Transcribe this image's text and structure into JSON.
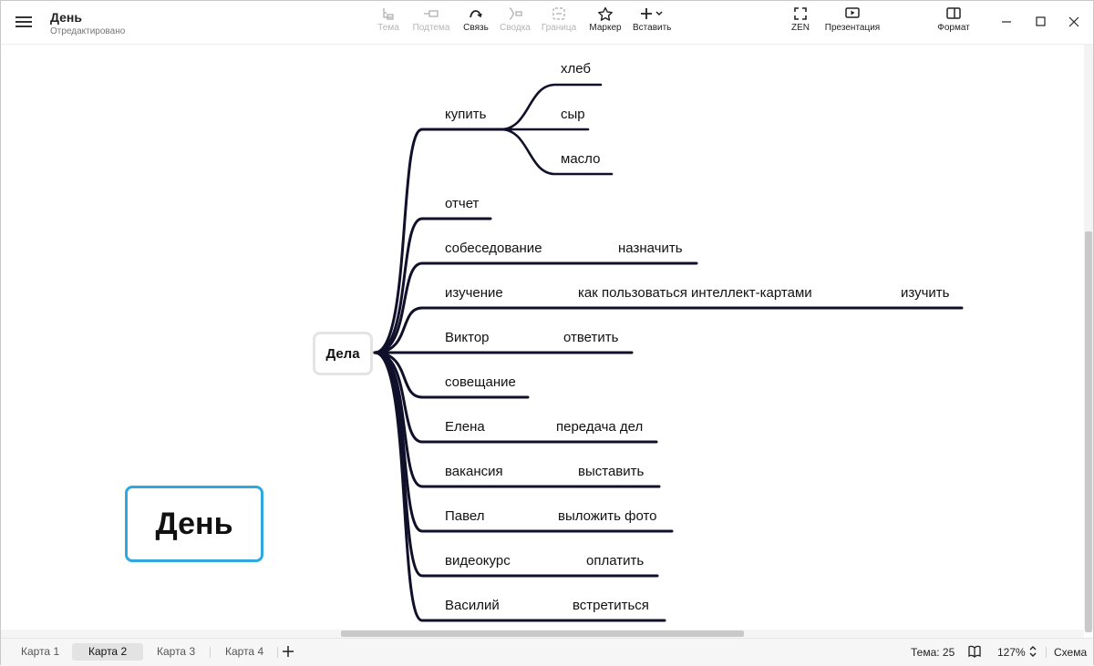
{
  "header": {
    "title": "День",
    "status": "Отредактировано"
  },
  "toolbar": {
    "theme": "Тема",
    "subtopic": "Подтема",
    "link": "Связь",
    "summary": "Сводка",
    "boundary": "Граница",
    "marker": "Маркер",
    "insert": "Вставить",
    "zen": "ZEN",
    "presentation": "Презентация",
    "format": "Формат"
  },
  "map": {
    "central": "Дела",
    "floating": "День",
    "branches": [
      {
        "label": "купить",
        "children": [
          "хлеб",
          "сыр",
          "масло"
        ]
      },
      {
        "label": "отчет"
      },
      {
        "label": "собеседование",
        "child": "назначить"
      },
      {
        "label": "изучение",
        "child": "как пользоваться интеллект-картами",
        "grandchild": "изучить"
      },
      {
        "label": "Виктор",
        "child": "ответить"
      },
      {
        "label": "совещание"
      },
      {
        "label": "Елена",
        "child": "передача дел"
      },
      {
        "label": "вакансия",
        "child": "выставить"
      },
      {
        "label": "Павел",
        "child": "выложить фото"
      },
      {
        "label": "видеокурс",
        "child": "оплатить"
      },
      {
        "label": "Василий",
        "child": "встретиться"
      }
    ]
  },
  "tabs": [
    "Карта 1",
    "Карта 2",
    "Карта 3",
    "Карта 4"
  ],
  "active_tab": "Карта 2",
  "status": {
    "theme": "Тема: 25",
    "zoom": "127%",
    "outline": "Схема"
  },
  "colors": {
    "line": "#10102a",
    "accent": "#2fa8e0"
  }
}
